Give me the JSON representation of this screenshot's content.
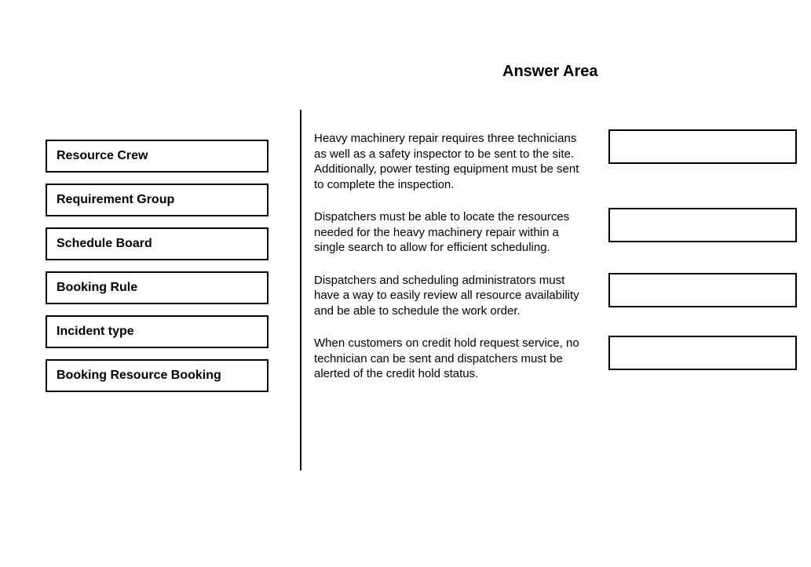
{
  "title": "Answer Area",
  "sources": [
    {
      "label": "Resource Crew"
    },
    {
      "label": "Requirement Group"
    },
    {
      "label": "Schedule Board"
    },
    {
      "label": "Booking Rule"
    },
    {
      "label": "Incident type"
    },
    {
      "label": "Booking Resource Booking"
    }
  ],
  "rows": [
    {
      "description": "Heavy machinery repair requires three technicians as well as a safety inspector to be sent to the site. Additionally, power testing equipment must be sent to complete the inspection."
    },
    {
      "description": "Dispatchers must be able to locate the resources needed for the heavy machinery repair within a single search to allow for efficient scheduling."
    },
    {
      "description": "Dispatchers and scheduling administrators must have a way to easily review all resource availability and be able to schedule the work order."
    },
    {
      "description": "When customers on credit hold request service, no technician can be sent and dispatchers must be alerted of the credit hold status."
    }
  ]
}
